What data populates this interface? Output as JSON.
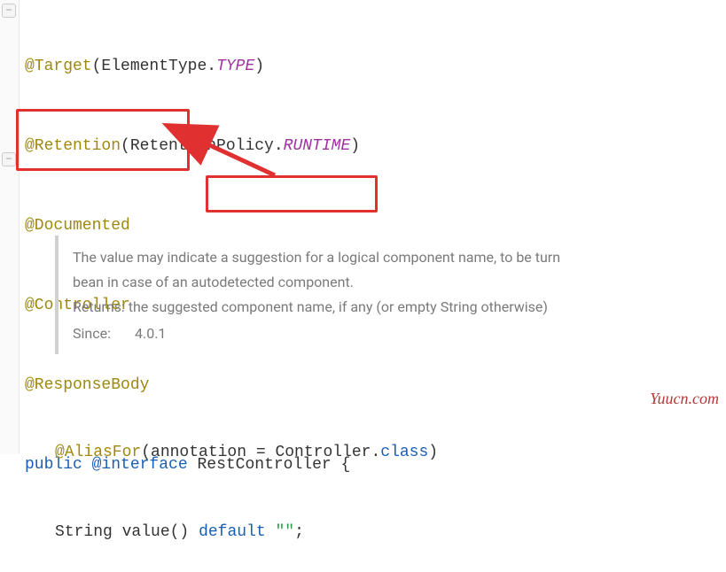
{
  "code": {
    "line1_at": "@Target",
    "line1_rest": "(ElementType.",
    "line1_type": "TYPE",
    "line1_close": ")",
    "line2_at": "@Retention",
    "line2_rest": "(RetentionPolicy.",
    "line2_type": "RUNTIME",
    "line2_close": ")",
    "line3_at": "@Documented",
    "line4_at": "@Controller",
    "line5_at": "@ResponseBody",
    "line6_kw_public": "public",
    "line6_kw_interface": "@interface",
    "line6_name": "RestController",
    "line6_brace": " {",
    "aliasfor_at": "@AliasFor",
    "aliasfor_rest": "(annotation = Controller.",
    "aliasfor_class": "class",
    "aliasfor_close": ")",
    "stringline_type": "String",
    "stringline_method": "value()",
    "stringline_default": "default",
    "stringline_str": "\"\"",
    "stringline_semi": ";"
  },
  "doc": {
    "p1": "The value may indicate a suggestion for a logical component name, to be turn",
    "p2": "bean in case of an autodetected component.",
    "returns": "Returns: the suggested component name, if any (or empty String otherwise)",
    "since_label": "Since:",
    "since_value": "4.0.1"
  },
  "watermark": "Yuucn.com"
}
